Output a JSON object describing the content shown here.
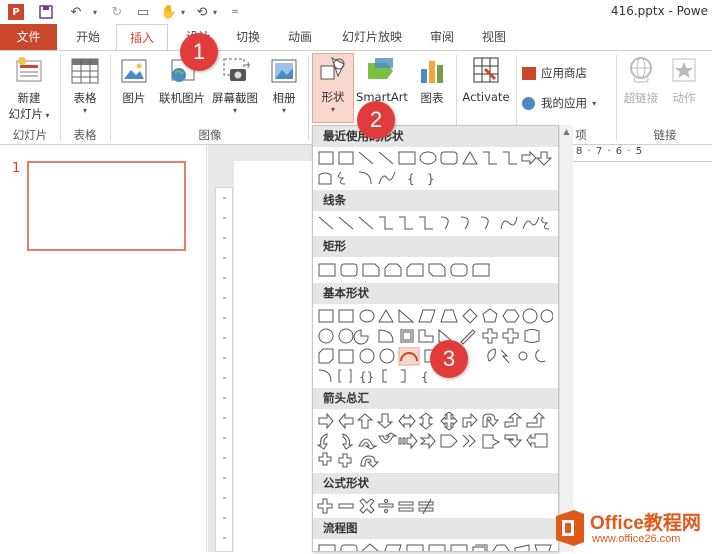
{
  "titlebar": {
    "filename": "416.pptx - Powe"
  },
  "tabs": [
    {
      "label": "文件"
    },
    {
      "label": "开始"
    },
    {
      "label": "插入"
    },
    {
      "label": "设计"
    },
    {
      "label": "切换"
    },
    {
      "label": "动画"
    },
    {
      "label": "幻灯片放映"
    },
    {
      "label": "审阅"
    },
    {
      "label": "视图"
    }
  ],
  "ribbon": {
    "new_slide": "新建",
    "new_slide2": "幻灯片",
    "table": "表格",
    "picture": "图片",
    "online_picture": "联机图片",
    "screenshot": "屏幕截图",
    "album": "相册",
    "shapes": "形状",
    "smartart": "SmartArt",
    "chart": "图表",
    "activate": "Activate",
    "app_store": "应用商店",
    "my_apps": "我的应用",
    "hyperlink": "超链接",
    "action": "动作",
    "groups": {
      "slides": "幻灯片",
      "tables": "表格",
      "images": "图像",
      "apps": "项",
      "links": "链接"
    }
  },
  "slides": [
    {
      "number": "1"
    }
  ],
  "ruler": {
    "h_text": "8 · 7 · 6 · 5"
  },
  "dropdown": {
    "sections": [
      {
        "title": "最近使用的形状"
      },
      {
        "title": "线条"
      },
      {
        "title": "矩形"
      },
      {
        "title": "基本形状"
      },
      {
        "title": "箭头总汇"
      },
      {
        "title": "公式形状"
      },
      {
        "title": "流程图"
      }
    ]
  },
  "badges": [
    "1",
    "2",
    "3"
  ],
  "watermark": {
    "brand": "Office教程网",
    "url": "www.office26.com"
  },
  "colors": {
    "accent": "#c9472a",
    "badge": "#e23b3b",
    "watermark": "#e05a1c"
  }
}
